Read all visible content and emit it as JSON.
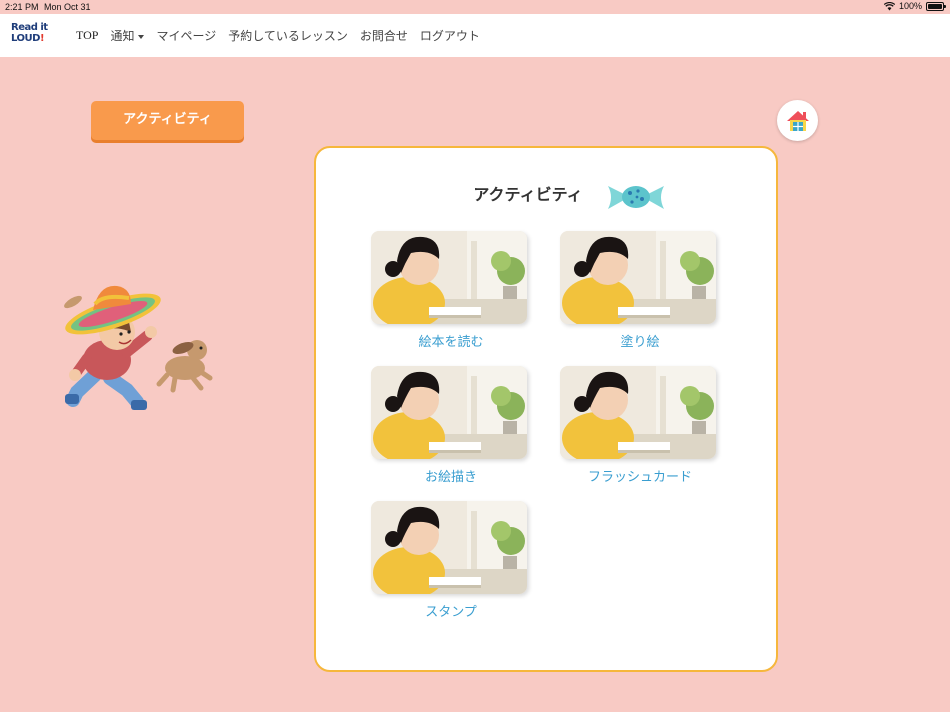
{
  "status": {
    "time": "2:21 PM",
    "date": "Mon Oct 31",
    "battery": "100%"
  },
  "logo": {
    "line1": "Read it",
    "line2": "LOUD",
    "mark": "!"
  },
  "nav": {
    "items": [
      {
        "label": "TOP"
      },
      {
        "label": "通知"
      },
      {
        "label": "マイページ"
      },
      {
        "label": "予約しているレッスン"
      },
      {
        "label": "お問合せ"
      },
      {
        "label": "ログアウト"
      }
    ]
  },
  "activity_tab": {
    "label": "アクティビティ"
  },
  "card": {
    "title": "アクティビティ",
    "tiles": [
      {
        "label": "絵本を読む"
      },
      {
        "label": "塗り絵"
      },
      {
        "label": "お絵描き"
      },
      {
        "label": "フラッシュカード"
      },
      {
        "label": "スタンプ"
      }
    ]
  },
  "colors": {
    "background": "#f8cac4",
    "accent_orange": "#f99a4c",
    "card_border": "#f6b73c",
    "link_blue": "#3a9ed0"
  },
  "icons": [
    "wifi-icon",
    "battery-icon",
    "home-icon",
    "candy-icon",
    "chevron-down-icon"
  ]
}
